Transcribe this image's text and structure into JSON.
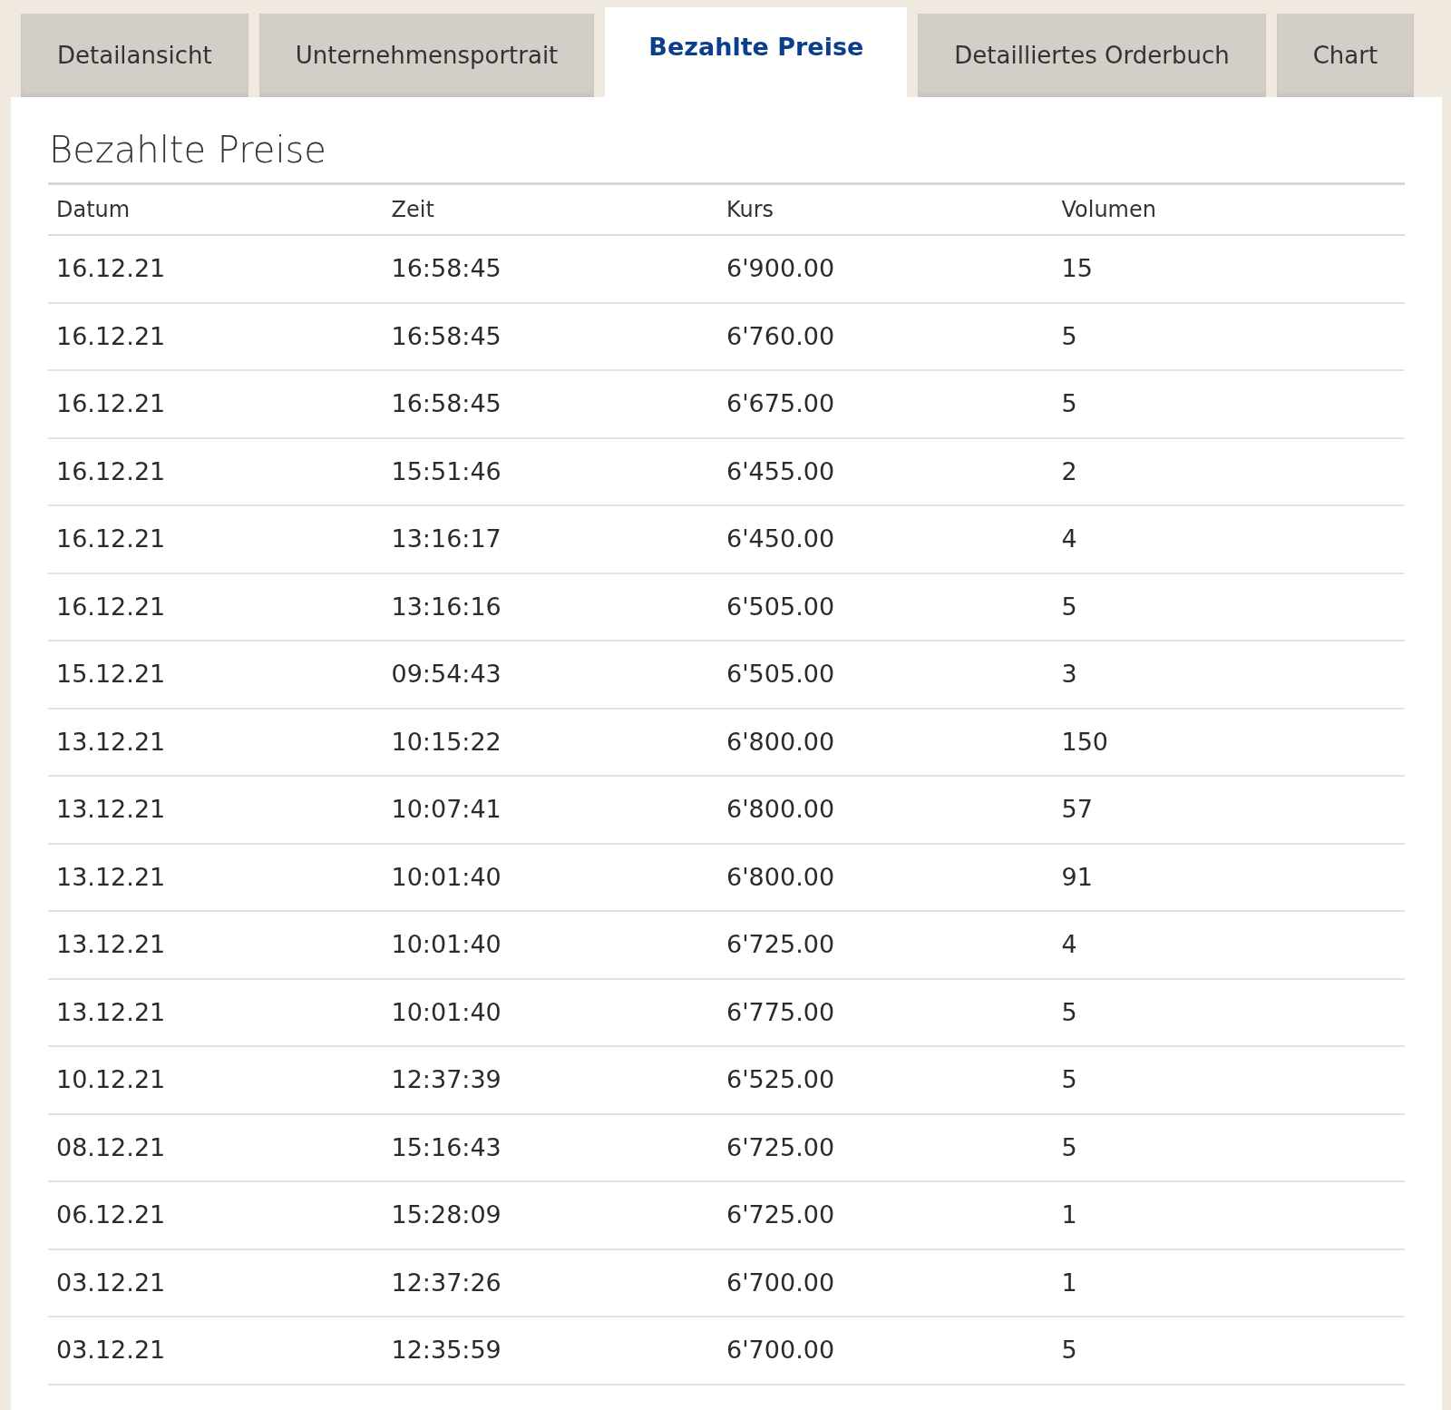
{
  "tabs": [
    {
      "label": "Detailansicht",
      "selected": false
    },
    {
      "label": "Unternehmensportrait",
      "selected": false
    },
    {
      "label": "Bezahlte Preise",
      "selected": true
    },
    {
      "label": "Detailliertes Orderbuch",
      "selected": false
    },
    {
      "label": "Chart",
      "selected": false
    }
  ],
  "heading": "Bezahlte Preise",
  "table": {
    "columns": [
      "Datum",
      "Zeit",
      "Kurs",
      "Volumen"
    ],
    "rows": [
      [
        "16.12.21",
        "16:58:45",
        "6'900.00",
        "15"
      ],
      [
        "16.12.21",
        "16:58:45",
        "6'760.00",
        "5"
      ],
      [
        "16.12.21",
        "16:58:45",
        "6'675.00",
        "5"
      ],
      [
        "16.12.21",
        "15:51:46",
        "6'455.00",
        "2"
      ],
      [
        "16.12.21",
        "13:16:17",
        "6'450.00",
        "4"
      ],
      [
        "16.12.21",
        "13:16:16",
        "6'505.00",
        "5"
      ],
      [
        "15.12.21",
        "09:54:43",
        "6'505.00",
        "3"
      ],
      [
        "13.12.21",
        "10:15:22",
        "6'800.00",
        "150"
      ],
      [
        "13.12.21",
        "10:07:41",
        "6'800.00",
        "57"
      ],
      [
        "13.12.21",
        "10:01:40",
        "6'800.00",
        "91"
      ],
      [
        "13.12.21",
        "10:01:40",
        "6'725.00",
        "4"
      ],
      [
        "13.12.21",
        "10:01:40",
        "6'775.00",
        "5"
      ],
      [
        "10.12.21",
        "12:37:39",
        "6'525.00",
        "5"
      ],
      [
        "08.12.21",
        "15:16:43",
        "6'725.00",
        "5"
      ],
      [
        "06.12.21",
        "15:28:09",
        "6'725.00",
        "1"
      ],
      [
        "03.12.21",
        "12:37:26",
        "6'700.00",
        "1"
      ],
      [
        "03.12.21",
        "12:35:59",
        "6'700.00",
        "5"
      ]
    ]
  }
}
